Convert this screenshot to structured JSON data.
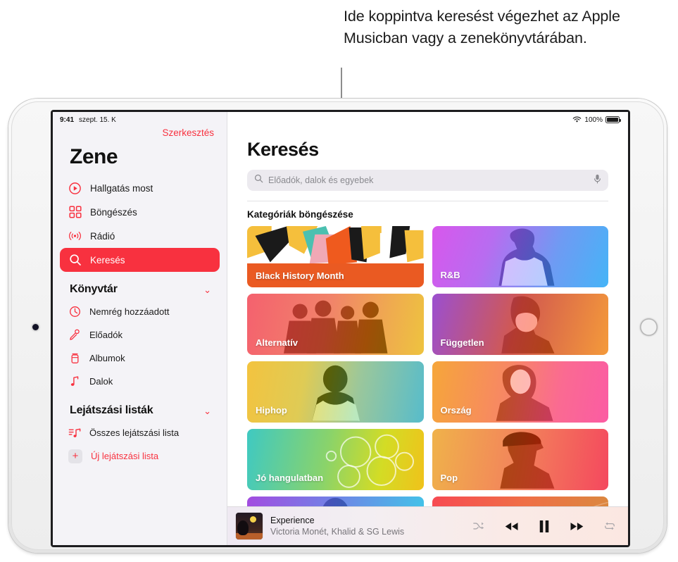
{
  "callout": {
    "text": "Ide koppintva keresést végezhet az Apple Musicban vagy a zenekönyvtárában."
  },
  "statusbar": {
    "time": "9:41",
    "date": "szept. 15. K",
    "battery_percent": "100%",
    "wifi_icon": "wifi-icon",
    "battery_icon": "battery-icon"
  },
  "sidebar": {
    "edit_label": "Szerkesztés",
    "app_title": "Zene",
    "nav": [
      {
        "label": "Hallgatás most",
        "icon": "play-circle-icon",
        "active": false
      },
      {
        "label": "Böngészés",
        "icon": "grid-icon",
        "active": false
      },
      {
        "label": "Rádió",
        "icon": "radio-waves-icon",
        "active": false
      },
      {
        "label": "Keresés",
        "icon": "search-icon",
        "active": true
      }
    ],
    "library": {
      "title": "Könyvtár",
      "chevron": "⌄",
      "items": [
        {
          "label": "Nemrég hozzáadott",
          "icon": "clock-icon"
        },
        {
          "label": "Előadók",
          "icon": "microphone-icon"
        },
        {
          "label": "Albumok",
          "icon": "album-icon"
        },
        {
          "label": "Dalok",
          "icon": "music-note-icon"
        }
      ]
    },
    "playlists": {
      "title": "Lejátszási listák",
      "chevron": "⌄",
      "items": [
        {
          "label": "Összes lejátszási lista",
          "icon": "playlist-icon"
        }
      ],
      "new_playlist_label": "Új lejátszási lista",
      "new_playlist_icon": "plus-icon"
    }
  },
  "main": {
    "page_title": "Keresés",
    "search": {
      "placeholder": "Előadók, dalok és egyebek",
      "value": "",
      "search_icon": "search-icon",
      "mic_icon": "microphone-icon"
    },
    "categories_heading": "Kategóriák böngészése",
    "tiles": [
      {
        "label": "Black History Month",
        "style": "collage",
        "from": "#f0a",
        "to": "#f0a"
      },
      {
        "label": "R&B",
        "style": "gradient",
        "from": "#d65ce8",
        "to": "#49a7f5"
      },
      {
        "label": "Alternatív",
        "style": "gradient",
        "from": "#f4616e",
        "to": "#f0b347"
      },
      {
        "label": "Független",
        "style": "gradient",
        "from": "#9b4fd0",
        "to": "#f5a63c"
      },
      {
        "label": "Hiphop",
        "style": "gradient",
        "from": "#f3c33f",
        "to": "#57bccb"
      },
      {
        "label": "Ország",
        "style": "gradient",
        "from": "#f6a63a",
        "to": "#fb5ca3"
      },
      {
        "label": "Jó hangulatban",
        "style": "gradient",
        "from": "#3fc9c2",
        "to": "#f2d000"
      },
      {
        "label": "Pop",
        "style": "gradient",
        "from": "#f0b24a",
        "to": "#f4485e"
      },
      {
        "label": "",
        "style": "gradient",
        "from": "#a34ce0",
        "to": "#3fc8e8"
      },
      {
        "label": "",
        "style": "gradient",
        "from": "#f74a52",
        "to": "#d98a3e"
      }
    ]
  },
  "player": {
    "track_title": "Experience",
    "track_artist": "Victoria Monét, Khalid & SG Lewis",
    "artwork_name": "album-artwork",
    "controls": [
      {
        "name": "shuffle-button",
        "icon": "shuffle-icon"
      },
      {
        "name": "previous-button",
        "icon": "rewind-icon"
      },
      {
        "name": "pause-button",
        "icon": "pause-icon"
      },
      {
        "name": "next-button",
        "icon": "fast-forward-icon"
      },
      {
        "name": "repeat-button",
        "icon": "repeat-icon"
      }
    ]
  },
  "colors": {
    "accent_red": "#f8313f",
    "sidebar_bg": "#f4f3f7",
    "text_primary": "#111111",
    "text_secondary": "#77757a"
  }
}
